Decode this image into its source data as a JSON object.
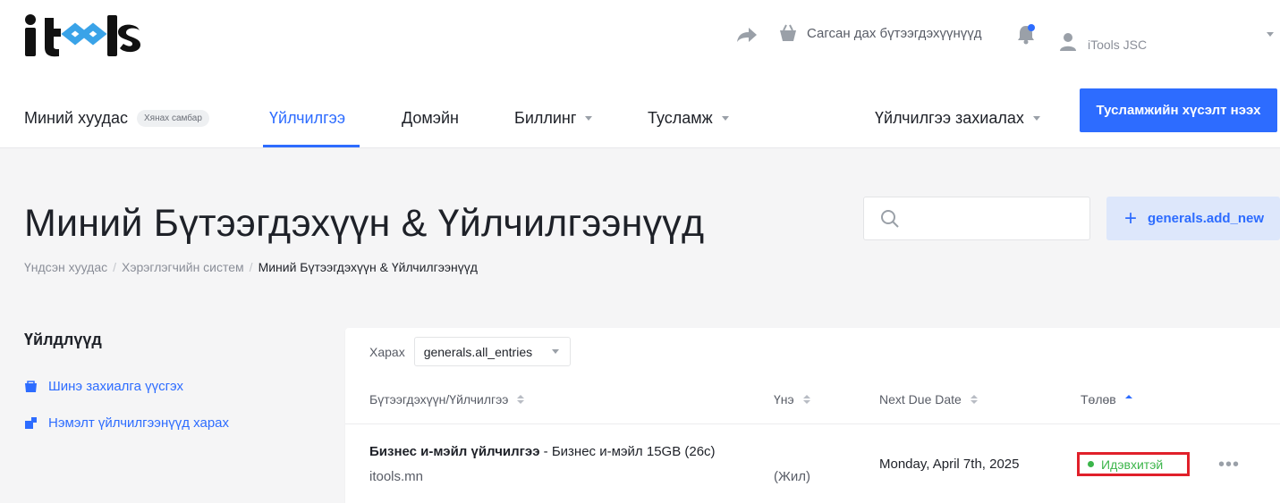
{
  "brand": {
    "logo_text": "itools"
  },
  "header": {
    "basket_label": "Сагсан дах бүтээгдэхүүнүүд",
    "user_name": "iTools JSC"
  },
  "nav": {
    "home": "Миний хуудас",
    "home_badge": "Хянах самбар",
    "services": "Үйлчилгээ",
    "domain": "Домэйн",
    "billing": "Биллинг",
    "support": "Тусламж",
    "order": "Үйлчилгээ захиалах",
    "ticket_button": "Тусламжийн хүсэлт нээх"
  },
  "page": {
    "title": "Миний Бүтээгдэхүүн & Үйлчилгээнүүд",
    "breadcrumb": [
      "Үндсэн хуудас",
      "Хэрэглэгчийн систем",
      "Миний Бүтээгдэхүүн & Үйлчилгээнүүд"
    ],
    "search_placeholder": "",
    "add_new_label": "generals.add_new"
  },
  "sidebar": {
    "title": "Үйлдлүүд",
    "actions": [
      "Шинэ захиалга үүсгэх",
      "Нэмэлт үйлчилгээнүүд харах"
    ]
  },
  "table": {
    "view_label": "Харах",
    "view_selected": "generals.all_entries",
    "columns": [
      "Бүтээгдэхүүн/Үйлчилгээ",
      "Үнэ",
      "Next Due Date",
      "Төлөв"
    ],
    "rows": [
      {
        "product_name": "Бизнес и-мэйл үйлчилгээ",
        "product_detail": " - Бизнес и-мэйл 15GB (26с)",
        "domain": "itools.mn",
        "price": "(Жил)",
        "due_date": "Monday, April 7th, 2025",
        "status": "Идэвхитэй"
      }
    ]
  },
  "colors": {
    "accent": "#2d6cff",
    "active_status": "#3bb54a",
    "highlight_border": "#e0202a"
  }
}
